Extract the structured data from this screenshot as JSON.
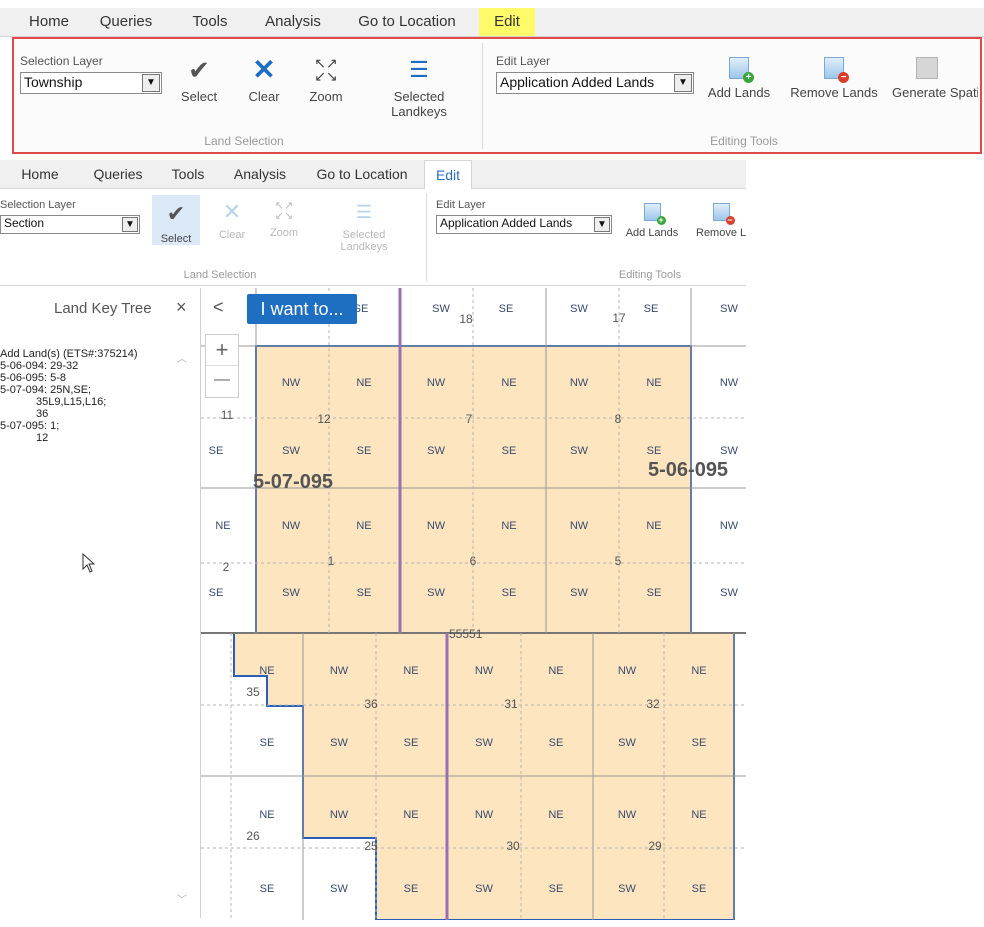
{
  "top_ribbon": {
    "tabs": [
      {
        "label": "Home"
      },
      {
        "label": "Queries"
      },
      {
        "label": "Tools"
      },
      {
        "label": "Analysis"
      },
      {
        "label": "Go to Location"
      },
      {
        "label": "Edit"
      }
    ],
    "selection_layer_label": "Selection Layer",
    "selection_layer_value": "Township",
    "select_label": "Select",
    "clear_label": "Clear",
    "zoom_label": "Zoom",
    "selected_landkeys_label": "Selected Landkeys",
    "land_selection_title": "Land Selection",
    "edit_layer_label": "Edit Layer",
    "edit_layer_value": "Application Added Lands",
    "add_lands_label": "Add Lands",
    "remove_lands_label": "Remove Lands",
    "generate_spatial_label": "Generate Spatia",
    "editing_tools_title": "Editing Tools",
    "highlight_color": "#e24a4a"
  },
  "lower_ribbon": {
    "tabs": [
      {
        "label": "Home"
      },
      {
        "label": "Queries"
      },
      {
        "label": "Tools"
      },
      {
        "label": "Analysis"
      },
      {
        "label": "Go to Location"
      },
      {
        "label": "Edit"
      }
    ],
    "selection_layer_label": "Selection Layer",
    "selection_layer_value": "Section",
    "select_label": "Select",
    "clear_label": "Clear",
    "zoom_label": "Zoom",
    "selected_landkeys_label": "Selected Landkeys",
    "land_selection_title": "Land Selection",
    "edit_layer_label": "Edit Layer",
    "edit_layer_value": "Application Added Lands",
    "add_lands_label": "Add Lands",
    "remove_lands_label": "Remove L",
    "editing_tools_title": "Editing Tools"
  },
  "panel": {
    "title": "Land Key Tree",
    "close_glyph": "×",
    "tree": [
      "Add Land(s) (ETS#:375214)",
      "5-06-094: 29-32",
      "5-06-095: 5-8",
      "5-07-094: 25N,SE;",
      "35L9,L15,L16;",
      "36",
      "5-07-095: 1;",
      "12"
    ]
  },
  "map": {
    "collapse_glyph": "<",
    "i_want_to_label": "I want to...",
    "zoom_in_glyph": "+",
    "zoom_out_glyph": "—",
    "selected_fill": "#fde5c0",
    "selection_outline": "#2b5eb8",
    "meridian_color": "#9b6fb3",
    "quarter_labels": [
      "SE",
      "SW",
      "SE",
      "SW",
      "SE",
      "SW",
      "NW",
      "NE",
      "NW",
      "NE",
      "NW",
      "NE",
      "NW",
      "SE",
      "SW",
      "SE",
      "SW",
      "SE",
      "SW",
      "SE",
      "SW",
      "NE",
      "NW",
      "NE",
      "NW",
      "NE",
      "NW",
      "NE",
      "NW",
      "SE",
      "SW",
      "SE",
      "SW",
      "SE",
      "SW",
      "SE",
      "SW",
      "NE",
      "NW",
      "NE",
      "NW",
      "NE",
      "NW",
      "NE",
      "SE",
      "SW",
      "SE",
      "SW",
      "SE",
      "SW",
      "SE",
      "NE",
      "NW",
      "NE",
      "NW",
      "NE",
      "NW",
      "NE",
      "SE",
      "SW",
      "SE",
      "SW",
      "SE",
      "SW",
      "SE"
    ],
    "section_numbers": [
      "18",
      "17",
      "11",
      "12",
      "7",
      "8",
      "2",
      "1",
      "6",
      "5",
      "35",
      "36",
      "31",
      "32",
      "26",
      "25",
      "30",
      "29"
    ],
    "township_labels": [
      "5-07-095",
      "5-06-095"
    ],
    "range_line_label": "55551"
  }
}
